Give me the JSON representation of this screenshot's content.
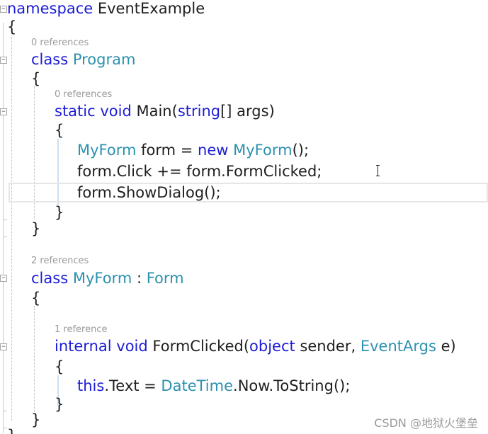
{
  "code": {
    "lines": [
      {
        "tokens": [
          [
            "kw",
            "namespace"
          ],
          [
            "tx",
            " EventExample"
          ]
        ]
      },
      {
        "tokens": [
          [
            "tx",
            "{"
          ]
        ]
      },
      {
        "tokens": [
          [
            "kw",
            "class"
          ],
          [
            "tx",
            " "
          ],
          [
            "ty",
            "Program"
          ]
        ]
      },
      {
        "tokens": [
          [
            "tx",
            "{"
          ]
        ]
      },
      {
        "tokens": [
          [
            "kw",
            "static"
          ],
          [
            "tx",
            " "
          ],
          [
            "kw",
            "void"
          ],
          [
            "tx",
            " Main("
          ],
          [
            "kw",
            "string"
          ],
          [
            "tx",
            "[] args)"
          ]
        ]
      },
      {
        "tokens": [
          [
            "tx",
            "{"
          ]
        ]
      },
      {
        "tokens": [
          [
            "ty",
            "MyForm"
          ],
          [
            "tx",
            " form = "
          ],
          [
            "kw",
            "new"
          ],
          [
            "tx",
            " "
          ],
          [
            "ty",
            "MyForm"
          ],
          [
            "tx",
            "();"
          ]
        ]
      },
      {
        "tokens": [
          [
            "tx",
            "form.Click += form.FormClicked;"
          ]
        ]
      },
      {
        "tokens": [
          [
            "tx",
            "form.ShowDialog();"
          ]
        ]
      },
      {
        "tokens": [
          [
            "tx",
            "}"
          ]
        ]
      },
      {
        "tokens": [
          [
            "tx",
            "}"
          ]
        ]
      },
      {
        "tokens": [
          [
            "kw",
            "class"
          ],
          [
            "tx",
            " "
          ],
          [
            "ty",
            "MyForm"
          ],
          [
            "tx",
            " : "
          ],
          [
            "ty",
            "Form"
          ]
        ]
      },
      {
        "tokens": [
          [
            "tx",
            "{"
          ]
        ]
      },
      {
        "tokens": [
          [
            "kw",
            "internal"
          ],
          [
            "tx",
            " "
          ],
          [
            "kw",
            "void"
          ],
          [
            "tx",
            " FormClicked("
          ],
          [
            "kw",
            "object"
          ],
          [
            "tx",
            " sender, "
          ],
          [
            "ty",
            "EventArgs"
          ],
          [
            "tx",
            " e)"
          ]
        ]
      },
      {
        "tokens": [
          [
            "tx",
            "{"
          ]
        ]
      },
      {
        "tokens": [
          [
            "kw",
            "this"
          ],
          [
            "tx",
            ".Text = "
          ],
          [
            "ty",
            "DateTime"
          ],
          [
            "tx",
            ".Now.ToString();"
          ]
        ]
      },
      {
        "tokens": [
          [
            "tx",
            "}"
          ]
        ]
      },
      {
        "tokens": [
          [
            "tx",
            "}"
          ]
        ]
      },
      {
        "tokens": [
          [
            "tx",
            "}"
          ]
        ]
      }
    ],
    "codelens": [
      "0 references",
      "0 references",
      "2 references",
      "1 reference"
    ]
  },
  "fold_glyph": "−",
  "watermark": "CSDN @地狱火堡垒",
  "colors": {
    "keyword": "#1c1cd6",
    "type": "#2b91af",
    "text": "#1e1e1e",
    "codelens": "#9a9a9a",
    "background": "#ffffff"
  },
  "icons": [
    "collapse-icon",
    "text-cursor-icon"
  ]
}
